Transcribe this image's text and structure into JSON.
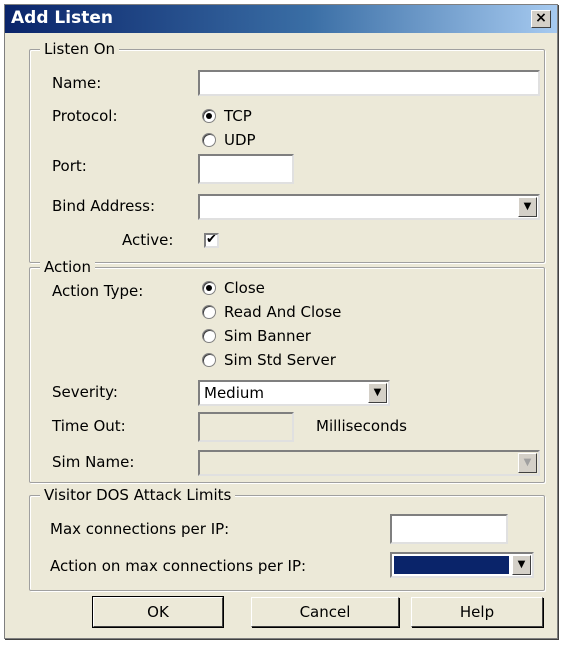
{
  "window": {
    "title": "Add Listen",
    "close_glyph": "×"
  },
  "listen_on": {
    "legend": "Listen On",
    "name_label": "Name:",
    "name_value": "",
    "protocol_label": "Protocol:",
    "protocol_options": [
      "TCP",
      "UDP"
    ],
    "protocol_selected": "TCP",
    "port_label": "Port:",
    "port_value": "",
    "bind_address_label": "Bind Address:",
    "bind_address_value": "",
    "active_label": "Active:",
    "active_checked": true,
    "check_glyph": "✔"
  },
  "action": {
    "legend": "Action",
    "action_type_label": "Action Type:",
    "action_type_options": [
      "Close",
      "Read And Close",
      "Sim Banner",
      "Sim Std Server"
    ],
    "action_type_selected": "Close",
    "severity_label": "Severity:",
    "severity_value": "Medium",
    "timeout_label": "Time Out:",
    "timeout_value": "",
    "timeout_unit": "Milliseconds",
    "sim_name_label": "Sim Name:",
    "sim_name_value": ""
  },
  "dos_limits": {
    "legend": "Visitor DOS Attack Limits",
    "max_conn_label": "Max connections per IP:",
    "max_conn_value": "",
    "action_on_max_label": "Action on max connections per IP:",
    "action_on_max_value": ""
  },
  "buttons": {
    "ok": "OK",
    "cancel": "Cancel",
    "help": "Help"
  },
  "colors": {
    "titlebar_start": "#0a246a",
    "titlebar_end": "#a6caf0",
    "dialog_bg": "#ece9d8",
    "selection": "#0a246a"
  }
}
